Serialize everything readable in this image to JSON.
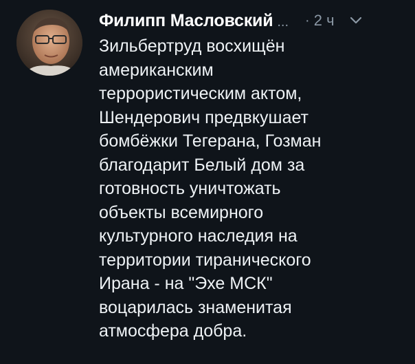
{
  "tweet": {
    "author_name": "Филипп Масловский",
    "name_truncation": "...",
    "separator": "·",
    "timestamp": "2 ч",
    "body_lines": [
      "Зильбертруд восхищён",
      "американским",
      "террористическим актом,",
      "Шендерович предвкушает",
      "бомбёжки Тегерана, Гозман",
      "благодарит Белый дом за",
      "готовность уничтожать",
      "объекты всемирного",
      "культурного наследия на",
      "территории тиранического",
      "Ирана - на \"Эхе МСК\"",
      "воцарилась знаменитая",
      "атмосфера добра."
    ]
  },
  "icons": {
    "menu": "chevron-down-icon",
    "avatar": "profile-photo"
  },
  "colors": {
    "background": "#0f141a",
    "primary_text": "#eef2f5",
    "secondary_text": "#8b98a5"
  }
}
